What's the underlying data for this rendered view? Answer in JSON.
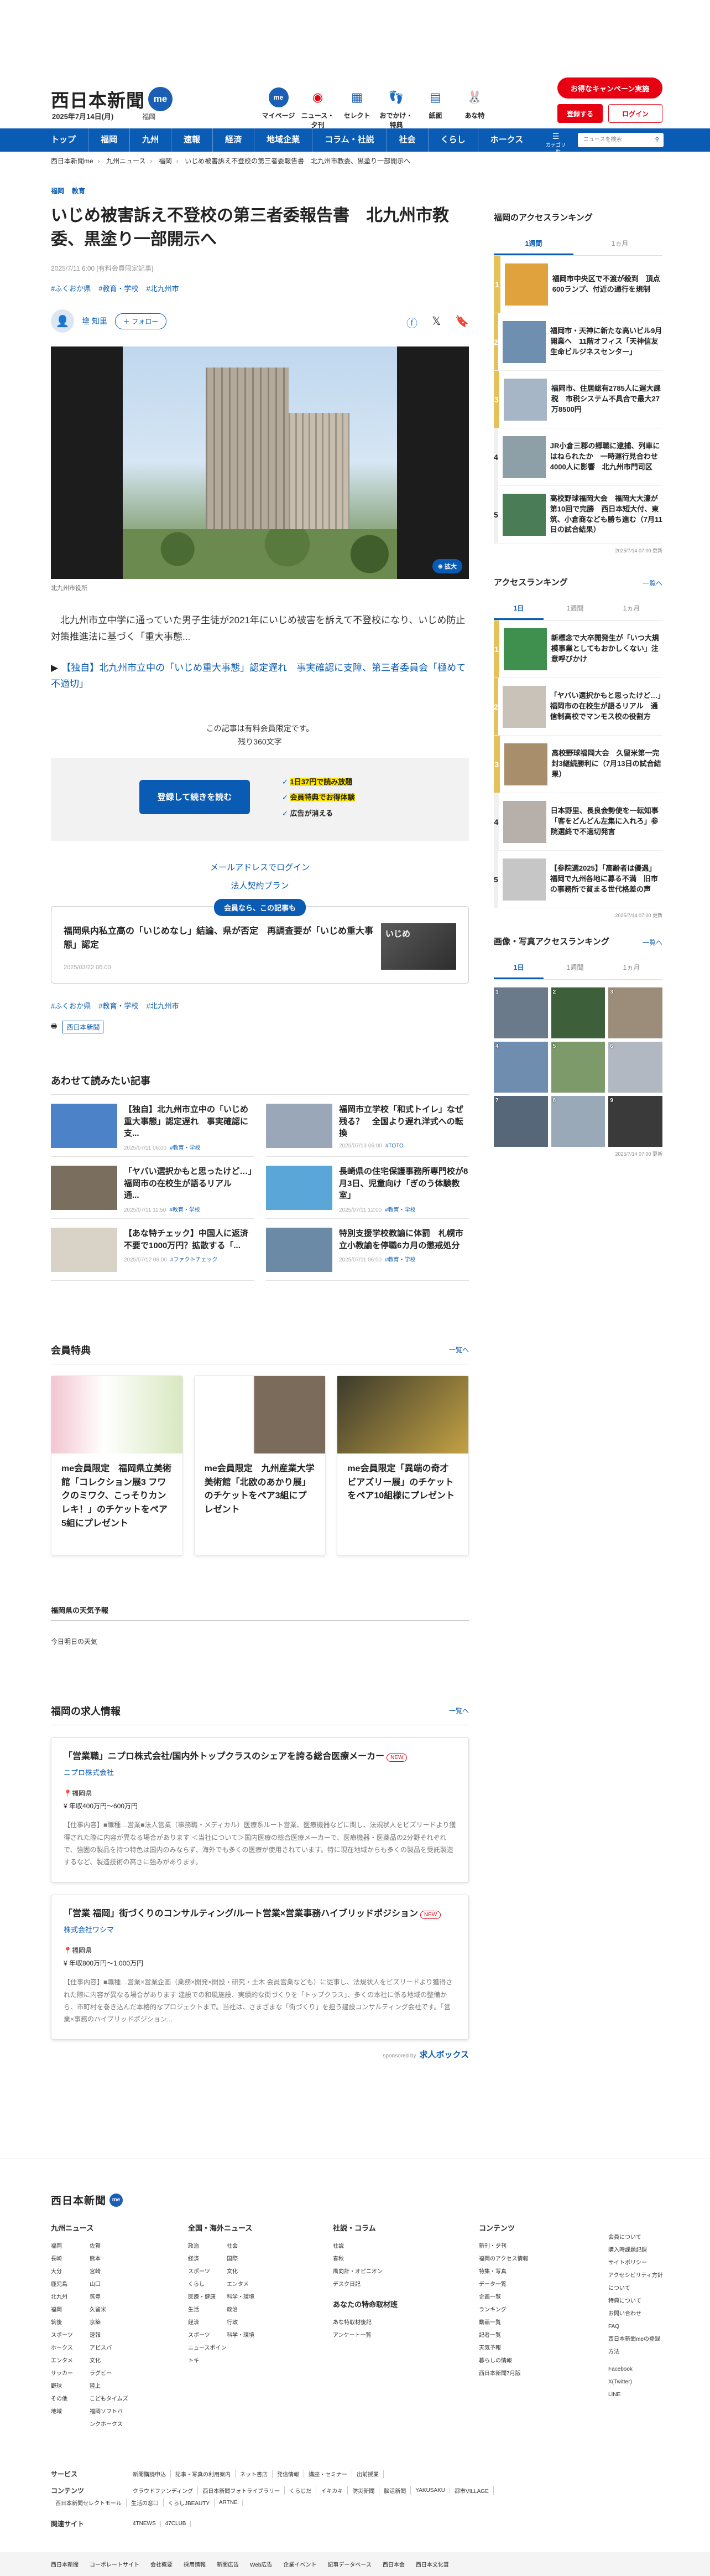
{
  "header": {
    "logo": "西日本新聞",
    "me": "me",
    "date": "2025年7月14日(月)",
    "region": "福岡",
    "nav": [
      {
        "label": "マイページ",
        "icon": "me-icon"
      },
      {
        "label": "ニュース・夕刊",
        "icon": "eye-icon"
      },
      {
        "label": "セレクト",
        "icon": "select-icon"
      },
      {
        "label": "おでかけ・特典",
        "icon": "footprints-icon"
      },
      {
        "label": "紙面",
        "icon": "paper-icon"
      },
      {
        "label": "あな特",
        "icon": "rabbit-icon"
      }
    ],
    "promo": "お得なキャンペーン実施",
    "register": "登録する",
    "login": "ログイン"
  },
  "gnav": {
    "items": [
      "トップ",
      "福岡",
      "九州",
      "速報",
      "経済",
      "地域企業",
      "コラム・社説",
      "社会",
      "くらし",
      "ホークス"
    ],
    "menu": "カテゴリ一覧",
    "search_placeholder": "ニュースを検索"
  },
  "breadcrumb": [
    "西日本新聞me",
    "九州ニュース",
    "福岡",
    "いじめ被害訴え不登校の第三者委報告書　北九州市教委、黒塗り一部開示へ"
  ],
  "article": {
    "tags": [
      "福岡",
      "教育"
    ],
    "title": "いじめ被害訴え不登校の第三者委報告書　北九州市教委、黒塗り一部開示へ",
    "date": "2025/7/11 6:00 [有料会員限定記事]",
    "hashtags": [
      "#ふくおか県",
      "#教育・学校",
      "#北九州市"
    ],
    "author": "壇 知里",
    "follow": "＋ フォロー",
    "zoom": "拡大",
    "caption": "北九州市役所",
    "lead": "北九州市立中学に通っていた男子生徒が2021年にいじめ被害を訴えて不登校になり、いじめ防止対策推進法に基づく「重大事態...",
    "related_prefix": "▶",
    "related": "【独自】北九州市立中の「いじめ重大事態」認定遅れ　事実確認に支障、第三者委員会「極めて不適切」",
    "paywall": [
      "この記事は有料会員限定です。",
      "残り360文字"
    ],
    "pay_button": "登録して続きを読む",
    "pay_points": [
      "1日37円で読み放題",
      "会員特典でお得体験",
      "広告が消える"
    ],
    "login_links": [
      "メールアドレスでログイン",
      "法人契約プラン"
    ],
    "member_free": {
      "label": "会員なら、この記事も",
      "title": "福岡県内私立高の「いじめなし」結論、県が否定　再調査要が「いじめ重大事態」認定",
      "date": "2025/03/22 06:00",
      "img_text": "いじめ"
    },
    "hashtags2": [
      "#ふくおか県",
      "#教育・学校",
      "#北九州市"
    ],
    "publisher": "西日本新聞"
  },
  "related_articles": {
    "title": "あわせて読みたい記事",
    "items": [
      {
        "title": "【独自】北九州市立中の「いじめ重大事態」認定遅れ　事実確認に支...",
        "date": "2025/07/11 06:00",
        "tag": "#教育・学校",
        "color": "#4b82c8"
      },
      {
        "title": "福岡市立学校「和式トイレ」なぜ残る？　全国より遅れ洋式への転換",
        "date": "2025/07/13 06:00",
        "tag": "#TOTO",
        "color": "#9aa7b8"
      },
      {
        "title": "「ヤバい選択かもと思ったけど…」福岡市の在校生が語るリアル　通...",
        "date": "2025/07/11 11:50",
        "tag": "#教育・学校",
        "color": "#7a6e5f"
      },
      {
        "title": "長崎県の住宅保護事務所専門校が8月3日、児童向け「ぎのう体験教室」",
        "date": "2025/07/11 12:00",
        "tag": "#教育・学校",
        "color": "#5aa6d8"
      },
      {
        "title": "【あな特チェック】中国人に返済不要で1000万円？拡散する「...",
        "date": "2025/07/12 06:00",
        "tag": "#ファクトチェック",
        "color": "#d8d3c6"
      },
      {
        "title": "特別支援学校教諭に体罰　札幌市立小教諭を停職6カ月の懲戒処分",
        "date": "2025/07/11 06:00",
        "tag": "#教育・学校",
        "color": "#6b8aa6"
      }
    ]
  },
  "perks": {
    "title": "会員特典",
    "more": "一覧へ",
    "items": [
      {
        "text": "me会員限定　福岡県立美術館「コレクション展3 フワクのミワク、こっそりカンレキ！」のチケットをペア5組にプレゼント"
      },
      {
        "text": "me会員限定　九州産業大学美術館「北欧のあかり展」のチケットをペア3組にプレゼント"
      },
      {
        "text": "me会員限定「異端の奇才 ビアズリー展」のチケットをペア10組様にプレゼント"
      }
    ]
  },
  "weather": {
    "title": "福岡県の天気予報",
    "sub": "今日明日の天気"
  },
  "jobs": {
    "title": "福岡の求人情報",
    "more": "一覧へ",
    "items": [
      {
        "title": "「営業職」ニプロ株式会社/国内外トップクラスのシェアを誇る総合医療メーカー",
        "new": "NEW",
        "company": "ニプロ株式会社",
        "location": "福岡県",
        "salary": "年収400万円〜600万円",
        "desc": "【仕事内容】■職種…営業■法人営業（事務職・メディカル）医療系ルート営業、医療機器などに関し、法規状人をビズリードより獲得された際に内容が異なる場合があります ＜当社について＞国内医療の総合医療メーカーで、医療機器・医薬品の2分野それぞれで、強固の製品を持つ特色は国内のみならず、海外でも多くの医療が使用されています。特に現在地域からも多くの製品を受託製造するなど、製造技術の高さに強みがあります。"
      },
      {
        "title": "「営業 福岡」街づくりのコンサルティング/ルート営業×営業事務ハイブリッドポジション",
        "new": "NEW",
        "company": "株式会社ワシマ",
        "location": "福岡県",
        "salary": "年収800万円〜1,000万円",
        "desc": "【仕事内容】■職種…営業×営業企画（業務×開発×開設・研究・土木 会員営業なども）に従事し、法規状人をビズリードより獲得された際に内容が異なる場合があります 建設での和風施設、実績的な街づくりを「トップクラス」、多くの本社に係る地域の整備から、市町村を巻き込んだ本格的なプロジェクトまで。当社は、さまざまな「街づくり」を担う建設コンサルティング会社です。「営業×事務のハイブリッドポジション..."
      }
    ],
    "sponsored": "sponsored by",
    "brand": "求人ボックス"
  },
  "sidebar": {
    "ranking": {
      "title": "福岡のアクセスランキング",
      "tabs": [
        "1週間",
        "1ヵ月"
      ],
      "items": [
        "福岡市中央区で不渡が殺到　頂点600ランプ、付近の通行を規制",
        "福岡市・天神に新たな高いビル9月開業へ　11階オフィス「天神信友生命ビルジネスセンター」",
        "福岡市、住居総有2785人に遅大課税　市税システム不具合で最大27万8500円",
        "JR小倉三郡の郷職に逮捕、列車にはねられたか　一時運行見合わせ4000人に影響　北九州市門司区",
        "高校野球福岡大会　福岡大大濠が第10回で完勝　西日本短大付、東筑、小倉商なども勝ち進む（7月11日の試合結果）"
      ],
      "stamp": "2025/7/14 07:00 更新"
    },
    "access": {
      "title": "アクセスランキング",
      "more": "一覧へ",
      "tabs": [
        "1日",
        "1週間",
        "1ヵ月"
      ],
      "items": [
        "新標念で大卒開発生が「いつ大規模事業としてもおかしくない」注意呼びかけ",
        "「ヤバい選択かもと思ったけど…」福岡市の在校生が語るリアル　通信制高校でマンモス校の役割方",
        "高校野球福岡大会　久留米第一完封3継続勝利に（7月13日の試合結果）",
        "日本野里、長良会勢使を一転知事「客をどんどん左集に入れろ」参院選終で不適切発言",
        "【参院選2025】「高齢者は優遇」福岡で九州各地に募る不満　旧市の事務所で貧まる世代格差の声"
      ],
      "stamp": "2025/7/14 07:00 更新"
    },
    "photos": {
      "title": "画像・写真アクセスランキング",
      "more": "一覧へ",
      "tabs": [
        "1日",
        "1週間",
        "1ヵ月"
      ],
      "stamp": "2025/7/14 07:00 更新",
      "nums": [
        "1",
        "2",
        "3",
        "4",
        "5",
        "6",
        "7",
        "8",
        "9"
      ]
    }
  },
  "footer": {
    "logo": "西日本新聞",
    "me": "me",
    "kyushu": {
      "title": "九州ニュース",
      "items": [
        "福岡",
        "佐賀",
        "長崎",
        "熊本",
        "大分",
        "宮崎",
        "鹿児島",
        "山口",
        "北九州",
        "筑豊",
        "福岡",
        "久留米",
        "筑後",
        "京築",
        "スポーツ",
        "速報",
        "ホークス",
        "アビスパ",
        "エンタメ",
        "文化",
        "サッカー",
        "ラグビー",
        "野球",
        "陸上",
        "その他",
        "こどもタイムズ",
        "地域",
        "福岡ソフトバンクホークス"
      ]
    },
    "world": {
      "title": "全国・海外ニュース",
      "items": [
        "政治",
        "社会",
        "経済",
        "国際",
        "スポーツ",
        "文化",
        "くらし",
        "エンタメ",
        "医療・健康",
        "科学・環境",
        "生活",
        "政治",
        "経済",
        "行政",
        "スポーツ",
        "科学・環境",
        "ニュースポイントキ"
      ]
    },
    "column": {
      "title": "社説・コラム",
      "items": [
        "社説",
        "春秋",
        "風向計・オピニオン",
        "デスク日記"
      ],
      "sub": "あなたの特命取材班",
      "sub_items": [
        "あな特取材後記",
        "アンケート一覧"
      ]
    },
    "content": {
      "title": "コンテンツ",
      "items": [
        "新刊・夕刊",
        "福岡のアクセス情報",
        "特集・写真",
        "データ一覧",
        "企画一覧",
        "ランキング",
        "動画一覧",
        "記者一覧",
        "天気予報",
        "暮らしの情報",
        "西日本新聞7月版"
      ]
    },
    "misc": {
      "items": [
        "会員について",
        "購入時課題記録",
        "サイトポリシー",
        "アクセシビリティ方針について",
        "特典について",
        "お問い合わせ",
        "FAQ",
        "西日本新聞meの登録方法"
      ],
      "social": [
        "Facebook",
        "X(Twitter)",
        "LINE"
      ]
    },
    "rows": [
      {
        "label": "サービス",
        "items": [
          "新聞購読申込",
          "記事・写真の利用案内",
          "ネット書店",
          "発信情報",
          "講座・セミナー",
          "出前授業"
        ]
      },
      {
        "label": "コンテンツ",
        "items": [
          "クラウドファンディング",
          "西日本新聞フォトライブラリー",
          "くらじだ",
          "イキカキ",
          "防災新聞",
          "脳活新聞",
          "YAKUSAKU",
          "都市VILLAGE",
          "西日本新聞セレクトモール",
          "生活の窓口",
          "くらしJBEAUTY",
          "ARTNE"
        ]
      },
      {
        "label": "関連サイト",
        "items": [
          "4TNEWS",
          "47CLUB"
        ]
      }
    ],
    "bottom": [
      "西日本新聞",
      "コーポレートサイト",
      "会社概要",
      "採用情報",
      "新聞広告",
      "Web広告",
      "企業イベント",
      "記事データベース",
      "西日本会",
      "西日本文化賞"
    ]
  }
}
